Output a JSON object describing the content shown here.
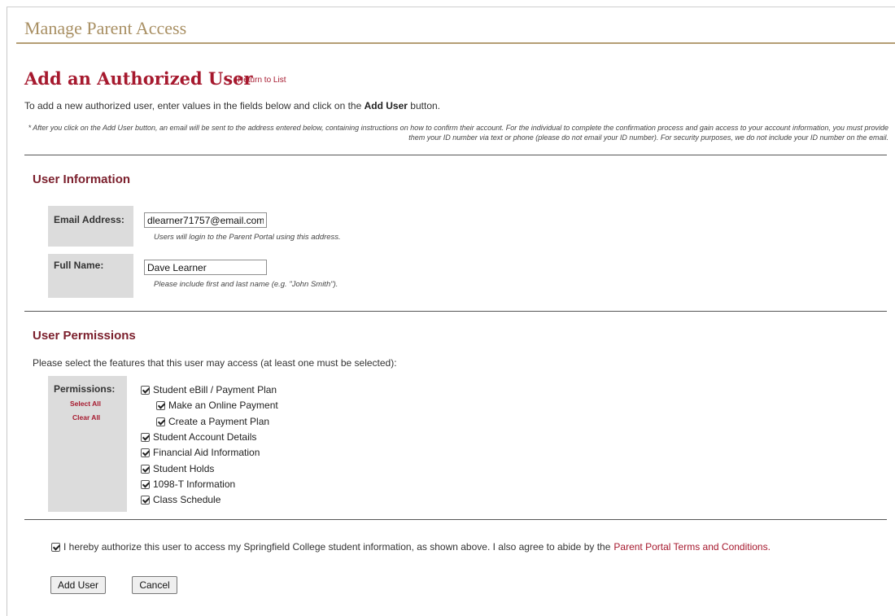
{
  "section_header": "Manage Parent Access",
  "page_title": "Add an Authorized User",
  "return_link": "Return to List",
  "intro": {
    "before": "To add a new authorized user, enter values in the fields below and click on the",
    "bold": "Add User",
    "after": "button."
  },
  "note": "* After you click on the Add User button, an email will be sent to the address entered below, containing instructions on how to confirm their account. For the individual to complete the confirmation process and gain access to your account information, you must provide them your ID number via text or phone (please do not email your ID number). For security purposes, we do not include your ID number on the email.",
  "user_info": {
    "heading": "User Information",
    "email": {
      "label": "Email Address:",
      "value": "dlearner71757@email.com",
      "hint": "Users will login to the Parent Portal using this address."
    },
    "full_name": {
      "label": "Full Name:",
      "value": "Dave Learner",
      "hint": "Please include first and last name (e.g. \"John Smith\")."
    }
  },
  "permissions": {
    "heading": "User Permissions",
    "intro": "Please select the features that this user may access (at least one must be selected):",
    "label": "Permissions:",
    "select_all": "Select All",
    "clear_all": "Clear All",
    "items": [
      {
        "label": "Student eBill / Payment Plan",
        "checked": true
      },
      {
        "label": "Make an Online Payment",
        "checked": true
      },
      {
        "label": "Create a Payment Plan",
        "checked": true
      },
      {
        "label": "Student Account Details",
        "checked": true
      },
      {
        "label": "Financial Aid Information",
        "checked": true
      },
      {
        "label": "Student Holds",
        "checked": true
      },
      {
        "label": "1098-T Information",
        "checked": true
      },
      {
        "label": "Class Schedule",
        "checked": true
      }
    ]
  },
  "authorization": {
    "text": "I hereby authorize this user to access my Springfield College student information, as shown above. I also agree to abide by the",
    "terms_link": "Parent Portal Terms and Conditions.",
    "checked": true
  },
  "buttons": {
    "add_user": "Add User",
    "cancel": "Cancel"
  },
  "colors": {
    "brand_red": "#a6192e",
    "header_gold": "#a99064",
    "subheading": "#7b1f2c",
    "label_bg": "#dcdcdc"
  }
}
